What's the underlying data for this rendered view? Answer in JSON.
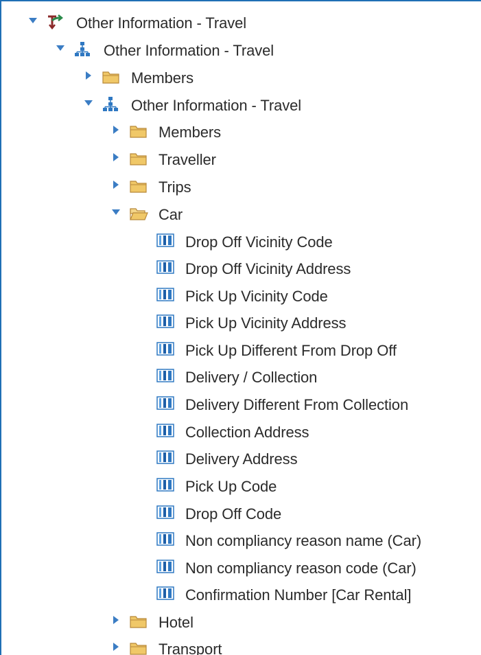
{
  "tree": {
    "root_label": "Other Information - Travel",
    "package_label": "Other Information - Travel",
    "package_members_label": "Members",
    "dimension_label": "Other Information - Travel",
    "folders": {
      "members": "Members",
      "traveller": "Traveller",
      "trips": "Trips",
      "car": "Car",
      "hotel": "Hotel",
      "transport": "Transport"
    },
    "car_items": [
      "Drop Off Vicinity Code",
      "Drop Off Vicinity Address",
      "Pick Up Vicinity Code",
      "Pick Up Vicinity Address",
      "Pick Up Different From Drop Off",
      "Delivery / Collection",
      "Delivery Different From Collection",
      "Collection Address",
      "Delivery Address",
      "Pick Up Code",
      "Drop Off Code",
      "Non compliancy reason name (Car)",
      "Non compliancy reason code (Car)",
      "Confirmation Number [Car Rental]"
    ]
  },
  "colors": {
    "accent_border": "#1f6fb5",
    "twisty": "#3b7dc4",
    "folder": "#f0c868",
    "attribute_icon": "#2f78c2"
  },
  "icons": {
    "expanded": "triangle-down-icon",
    "collapsed": "triangle-right-icon",
    "root": "namespace-arrows-icon",
    "hierarchy": "hierarchy-icon",
    "folder": "folder-icon",
    "folder_open": "folder-open-icon",
    "attribute": "column-attribute-icon"
  }
}
